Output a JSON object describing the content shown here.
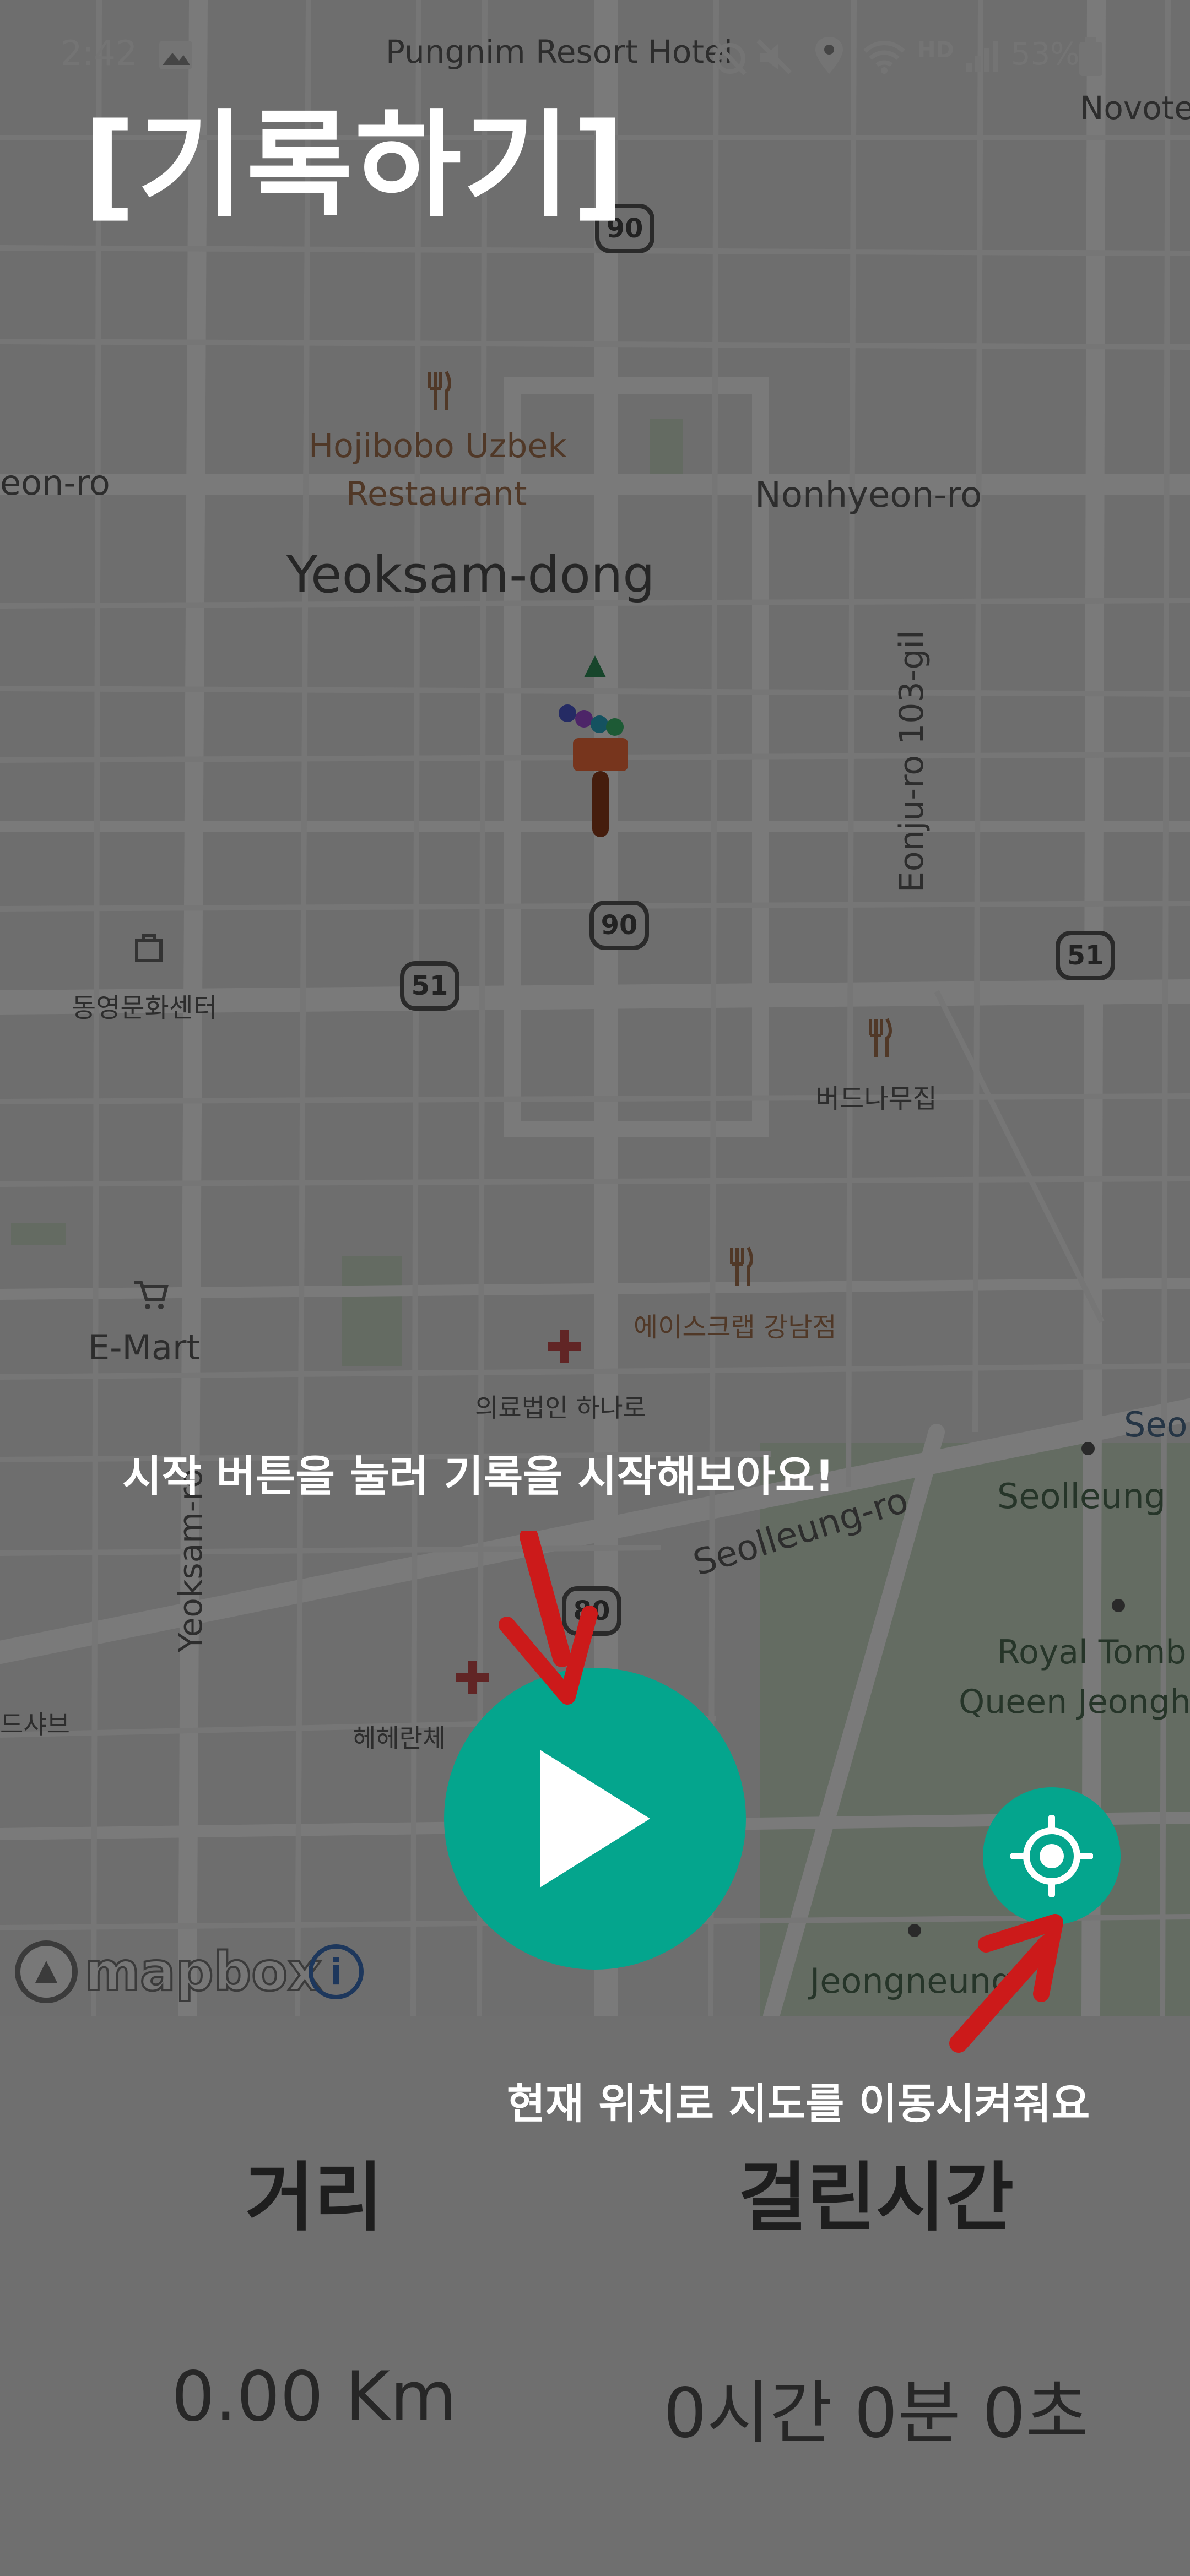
{
  "status_bar": {
    "clock": "2:42",
    "battery": "53%",
    "network": "HD"
  },
  "map": {
    "labels": {
      "pungnim": "Pungnim Resort Hotel",
      "novotel": "Novote",
      "hojibobo_line1": "Hojibobo Uzbek",
      "hojibobo_line2": "Restaurant",
      "eon_ro": "eon-ro",
      "nonhyeon_ro": "Nonhyeon-ro",
      "yeoksam_dong": "Yeoksam-dong",
      "eonju_ro": "Eonju-ro 103-gil",
      "dongyeong": "동영문화센터",
      "beodnamu": "버드나무집",
      "emart": "E-Mart",
      "ace_crab": "에이스크랩 강남점",
      "hospital_line1": "의료법인 하나로",
      "yeoksam_ro": "Yeoksam-ro",
      "seolleung_ro": "Seolleung-ro",
      "seolleung": "Seolleung",
      "seo": "Seo",
      "royal_line1": "Royal Tomb",
      "royal_line2": "Queen Jeongh",
      "hyehye": "헤헤란체",
      "jeongneung": "Jeongneung",
      "left_cut": "드샤브"
    },
    "shields": {
      "r90_top": "90",
      "r90_mid": "90",
      "r51_left": "51",
      "r51_right": "51",
      "r90_low": "80"
    },
    "attribution": "mapbox",
    "info_icon_char": "i"
  },
  "tutorial": {
    "title": "[기록하기]",
    "start_hint": "시작 버튼을 눌러 기록을 시작해보아요!",
    "location_hint": "현재 위치로 지도를 이동시켜줘요"
  },
  "stats": {
    "distance_label": "거리",
    "time_label": "걸린시간",
    "distance_value": "0.00 Km",
    "time_value": "0시간 0분 0초"
  },
  "colors": {
    "accent": "#04a58d",
    "arrow": "#cc1a1a"
  }
}
